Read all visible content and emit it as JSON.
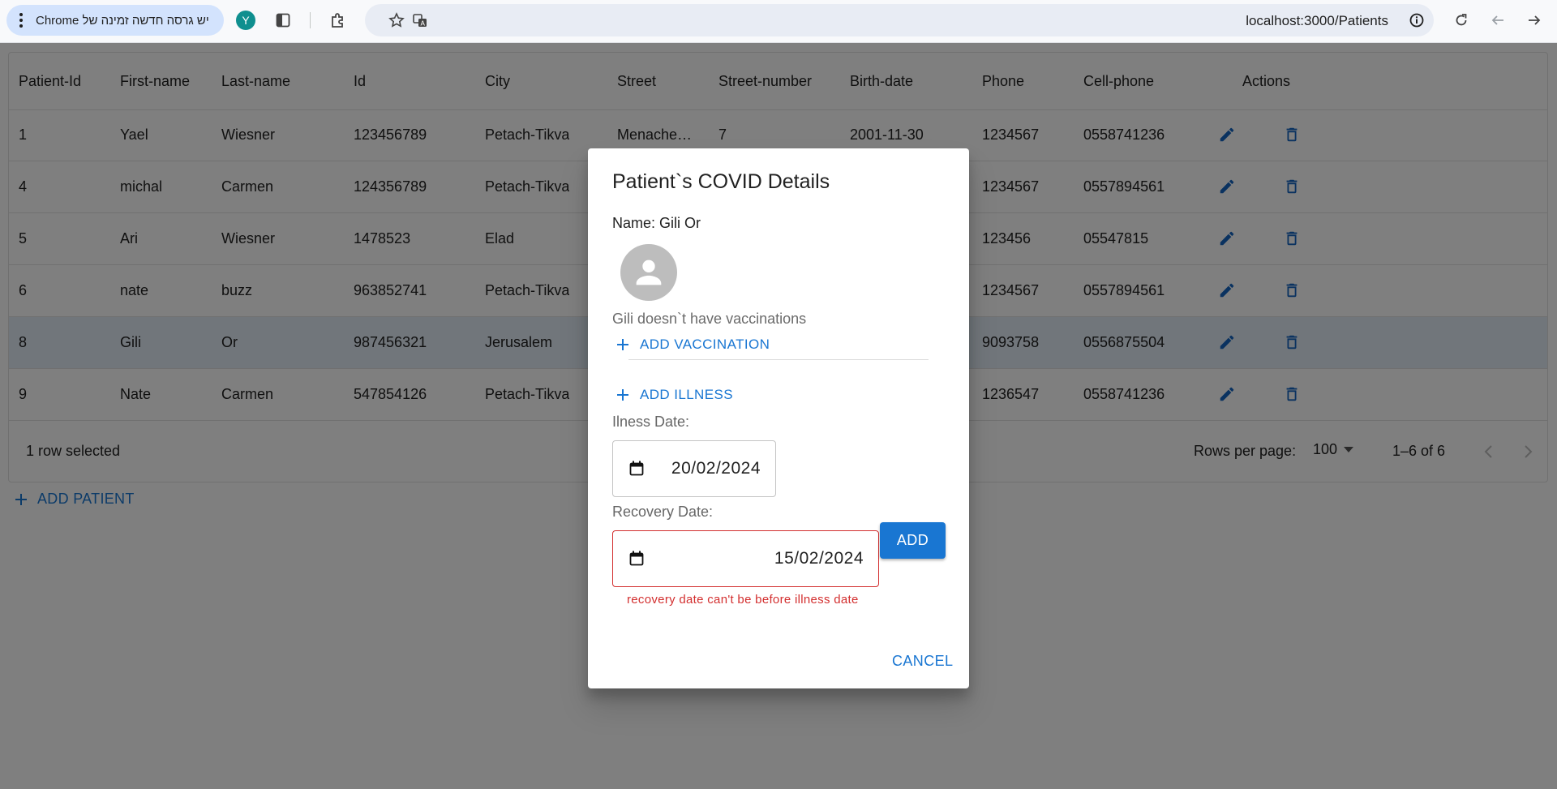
{
  "browser": {
    "update_text": "יש גרסה חדשה זמינה של Chrome",
    "profile_initial": "Y",
    "url": "localhost:3000/Patients"
  },
  "grid": {
    "columns": [
      "Patient-Id",
      "First-name",
      "Last-name",
      "Id",
      "City",
      "Street",
      "Street-number",
      "Birth-date",
      "Phone",
      "Cell-phone",
      "Actions"
    ],
    "rows": [
      [
        "1",
        "Yael",
        "Wiesner",
        "123456789",
        "Petach-Tikva",
        "Menache…",
        "7",
        "2001-11-30",
        "1234567",
        "0558741236"
      ],
      [
        "4",
        "michal",
        "Carmen",
        "124356789",
        "Petach-Tikva",
        "",
        "",
        "",
        "1234567",
        "0557894561"
      ],
      [
        "5",
        "Ari",
        "Wiesner",
        "1478523",
        "Elad",
        "",
        "",
        "",
        "123456",
        "05547815"
      ],
      [
        "6",
        "nate",
        "buzz",
        "963852741",
        "Petach-Tikva",
        "",
        "",
        "",
        "1234567",
        "0557894561"
      ],
      [
        "8",
        "Gili",
        "Or",
        "987456321",
        "Jerusalem",
        "",
        "",
        "",
        "9093758",
        "0556875504"
      ],
      [
        "9",
        "Nate",
        "Carmen",
        "547854126",
        "Petach-Tikva",
        "",
        "",
        "",
        "1236547",
        "0558741236"
      ]
    ],
    "selected_row_index": 4,
    "footer": {
      "selected_text": "1 row selected",
      "rows_per_page_label": "Rows per page:",
      "rows_per_page_value": "100",
      "range_text": "1–6 of 6"
    }
  },
  "add_patient_label": "ADD PATIENT",
  "dialog": {
    "title": "Patient`s COVID Details",
    "name_line": "Name: Gili Or",
    "no_vaccinations_text": "Gili doesn`t have vaccinations",
    "add_vaccination_label": "ADD VACCINATION",
    "add_illness_label": "ADD ILLNESS",
    "illness_date_label": "Ilness Date:",
    "illness_date_value": "20/02/2024",
    "recovery_date_label": "Recovery Date:",
    "recovery_date_value": "15/02/2024",
    "recovery_error": "recovery date can't be before illness date",
    "add_button_label": "ADD",
    "cancel_button_label": "CANCEL"
  },
  "colors": {
    "primary": "#1976d2",
    "error": "#d32f2f",
    "selected_row": "#e3ecf6"
  }
}
